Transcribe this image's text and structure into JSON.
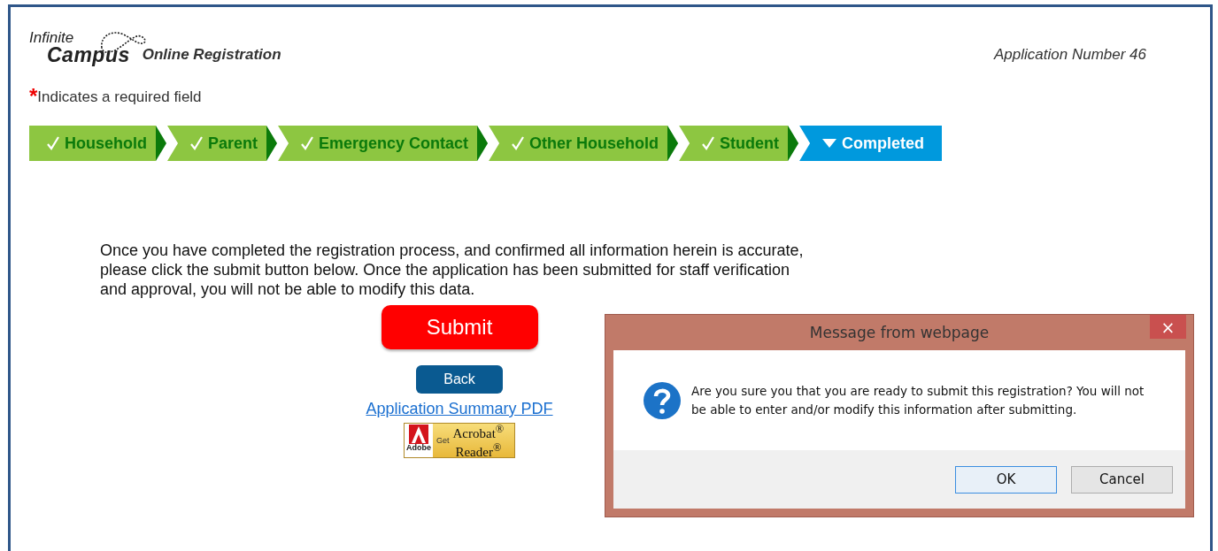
{
  "header": {
    "logo_top": "Infinite",
    "logo_bottom": "Campus",
    "title": "Online Registration",
    "application_number": "Application Number 46"
  },
  "required_note": {
    "marker": "*",
    "text": "Indicates a required field"
  },
  "steps": [
    {
      "label": "Household",
      "selected": false
    },
    {
      "label": "Parent",
      "selected": false
    },
    {
      "label": "Emergency Contact",
      "selected": false
    },
    {
      "label": "Other Household",
      "selected": false
    },
    {
      "label": "Student",
      "selected": false
    },
    {
      "label": "Completed",
      "selected": true
    }
  ],
  "instructions": "Once you have completed the registration process, and confirmed all information herein is accurate, please click the submit button below. Once the application has been submitted for staff verification and approval, you will not be able to modify this data.",
  "submit_button": "Submit",
  "back_button": "Back",
  "summary_link": "Application Summary PDF",
  "reader_badge": {
    "brand": "Adobe",
    "get": "Get",
    "line_1": "Acrobat$^{®}$",
    "line_2": "Reader$^{®}$"
  },
  "dialog": {
    "title": "Message from webpage",
    "close": "×",
    "message": "Are you sure you that you are ready to submit this registration? You will not be able to enter and/or modify this information after submitting.",
    "buttons": [
      {
        "label": "OK",
        "selected": true
      },
      {
        "label": "Cancel",
        "selected": false
      }
    ]
  }
}
